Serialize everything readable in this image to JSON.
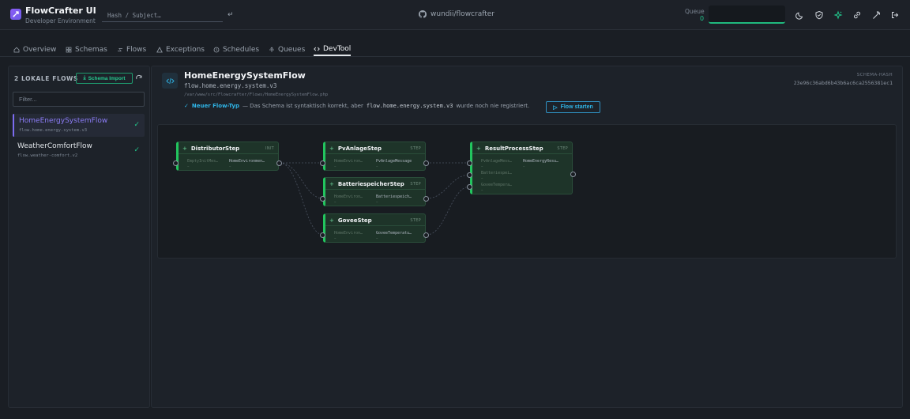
{
  "header": {
    "app_title": "FlowCrafter UI",
    "app_subtitle": "Developer Environment",
    "search_placeholder": "Hash / Subject…",
    "enter_icon": "↵",
    "repo": "wundii/flowcrafter",
    "queue_label": "Queue",
    "queue_count": "0",
    "icons": [
      "moon-icon",
      "shield-icon",
      "sparkle-icon",
      "link-icon",
      "wrench-icon",
      "logout-icon"
    ],
    "accent": "#22c58b"
  },
  "nav": {
    "tabs": [
      {
        "label": "Overview",
        "icon": "home-icon"
      },
      {
        "label": "Schemas",
        "icon": "grid-icon"
      },
      {
        "label": "Flows",
        "icon": "flow-icon"
      },
      {
        "label": "Exceptions",
        "icon": "warning-icon"
      },
      {
        "label": "Schedules",
        "icon": "clock-icon"
      },
      {
        "label": "Queues",
        "icon": "queue-icon"
      },
      {
        "label": "DevTool",
        "icon": "code-icon",
        "active": true
      }
    ]
  },
  "sidebar": {
    "title": "2 LOKALE FLOWS",
    "import_label": "Schema Import",
    "filter_placeholder": "Filter...",
    "flows": [
      {
        "name": "HomeEnergySystemFlow",
        "subject": "flow.home.energy.system.v3",
        "selected": true,
        "color": "#8b7cf6"
      },
      {
        "name": "WeatherComfortFlow",
        "subject": "flow.weather-comfort.v2",
        "selected": false,
        "color": "#e2e6ea"
      }
    ]
  },
  "main": {
    "title": "HomeEnergySystemFlow",
    "subject": "flow.home.energy.system.v3",
    "path": "/var/www/src/Flowcrafter/Flows/HomeEnergySystemFlow.php",
    "new_type_label": "Neuer Flow-Typ",
    "new_type_text1": "— Das Schema ist syntaktisch korrekt, aber",
    "new_type_code": "flow.home.energy.system.v3",
    "new_type_text2": "wurde noch nie registriert.",
    "start_label": "Flow starten",
    "hash_label": "SCHEMA-HASH",
    "hash_value": "23e96c36abd6b43b6ac6ca2556381ec1"
  },
  "nodes": {
    "distributor": {
      "name": "DistributorStep",
      "type": "INIT",
      "in": "EmptyInitMes…",
      "out": "HomeEnvironmen…"
    },
    "pvanlage": {
      "name": "PvAnlageStep",
      "type": "STEP",
      "in": "HomeEnviron…",
      "out": "PvAnlageMessage"
    },
    "batterie": {
      "name": "BatteriespeicherStep",
      "type": "STEP",
      "in": "HomeEnviron…",
      "out": "Batteriespeich…"
    },
    "govee": {
      "name": "GoveeStep",
      "type": "STEP",
      "in": "HomeEnviron…",
      "out": "GoveeTemperatu…"
    },
    "result": {
      "name": "ResultProcessStep",
      "type": "STEP",
      "in1": "PvAnlageMess…",
      "in2": "Batteriespei…",
      "in3": "GoveeTempera…",
      "out": "HomeEnergyResu…"
    },
    "dash": "–"
  }
}
